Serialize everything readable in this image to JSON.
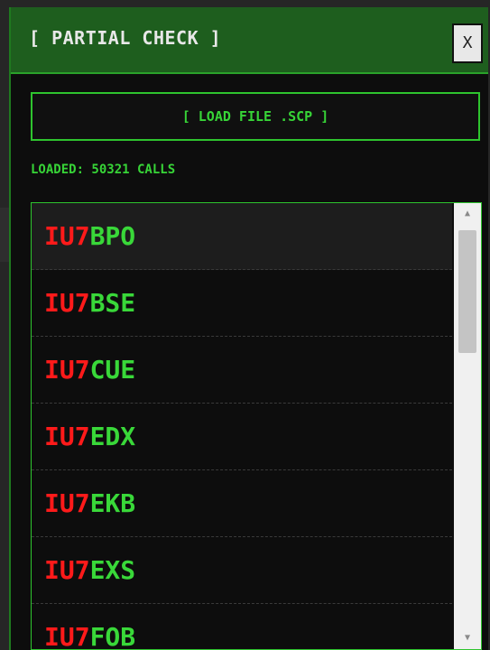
{
  "dialog": {
    "title": "[ PARTIAL CHECK ]",
    "close_label": "X",
    "load_button_label": "[ LOAD FILE .SCP ]",
    "status": "LOADED: 50321 CALLS"
  },
  "calls": [
    {
      "prefix": "IU7",
      "suffix": "BPO"
    },
    {
      "prefix": "IU7",
      "suffix": "BSE"
    },
    {
      "prefix": "IU7",
      "suffix": "CUE"
    },
    {
      "prefix": "IU7",
      "suffix": "EDX"
    },
    {
      "prefix": "IU7",
      "suffix": "EKB"
    },
    {
      "prefix": "IU7",
      "suffix": "EXS"
    },
    {
      "prefix": "IU7",
      "suffix": "FOB"
    }
  ],
  "scrollbar": {
    "up_icon": "scroll-up-arrow-icon",
    "down_icon": "scroll-down-arrow-icon"
  },
  "colors": {
    "title_bar": "#1e5e1e",
    "accent_green": "#37d437",
    "prefix_red": "#ff1a1a",
    "background": "#0d0d0d"
  }
}
